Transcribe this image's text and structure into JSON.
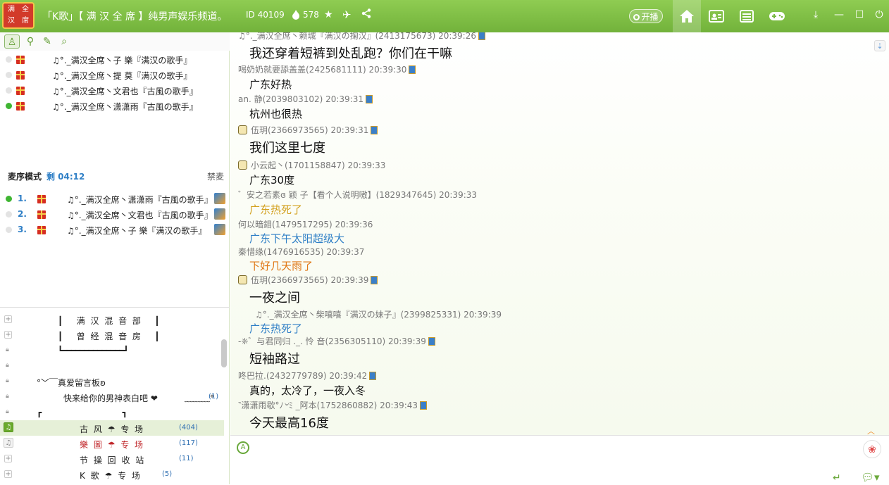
{
  "titlebar": {
    "title": "「K歌」【 满 汉 全 席 】纯男声娱乐频道。",
    "room_id": "ID 40109",
    "popularity": "578",
    "broadcast_label": "开播",
    "logo_text": [
      "满",
      "全",
      "汉",
      "席"
    ]
  },
  "online_users": [
    {
      "name": "♫°._满汉全席丶子   樂『满汉の歌手』",
      "online": false
    },
    {
      "name": "♫°._满汉全席丶提   莫『满汉の歌手』",
      "online": false
    },
    {
      "name": "♫°._满汉全席丶文君也『古風の歌手』",
      "online": false
    },
    {
      "name": "♫°._满汉全席丶潇潇雨『古風の歌手』",
      "online": true
    }
  ],
  "queue": {
    "mode_label": "麦序模式",
    "remaining": "剩 04:12",
    "ban_label": "禁麦",
    "items": [
      {
        "num": "1.",
        "name": "♫°._满汉全席丶潇潇雨『古風の歌手』",
        "online": true
      },
      {
        "num": "2.",
        "name": "♫°._满汉全席丶文君也『古風の歌手』",
        "online": false
      },
      {
        "num": "3.",
        "name": "♫°._满汉全席丶子   樂『满汉の歌手』",
        "online": false
      }
    ]
  },
  "rooms": [
    {
      "icon": "expand",
      "name": "┃   满 汉 混 音 部   ┃",
      "count": ""
    },
    {
      "icon": "expand",
      "name": "┃   曾 经 混 音 房   ┃",
      "count": ""
    },
    {
      "icon": "lock",
      "name": "┗━━━━━━━━━━━━━━┛",
      "count": ""
    },
    {
      "icon": "lock",
      "name": "",
      "count": ""
    },
    {
      "icon": "lock",
      "name": "°﹀￣真爱留言板ʚ",
      "count": ""
    },
    {
      "icon": "lock",
      "name": "快来给你的男神表白吧 ❤          ﹏﹏﹏°",
      "count": "(1)"
    },
    {
      "icon": "lock",
      "name": "┏                              ┓",
      "count": ""
    },
    {
      "icon": "music-green",
      "name": "古 风 ☂ 专 场",
      "count": "(404)"
    },
    {
      "icon": "music",
      "name": "樂 圖 ☂ 专 场",
      "count": "(117)"
    },
    {
      "icon": "expand",
      "name": "节 操 回 收 站",
      "count": "(11)"
    },
    {
      "icon": "expand",
      "name": "K 歌 ☂ 专 场",
      "count": "(5)"
    }
  ],
  "chat": [
    {
      "meta": "♫°._满汉全席丶赖城『满汉の掬汉』(2413175673) 20:39:26",
      "text": "我还穿着短裤到处乱跑？你们在干嘛",
      "size": "lg",
      "color": ""
    },
    {
      "meta": "喝奶奶就要舔盖盖(2425681111) 20:39:30",
      "text": "广东好热",
      "size": "md",
      "color": ""
    },
    {
      "meta": "an. 静(2039803102) 20:39:31",
      "text": "杭州也很热",
      "size": "md",
      "color": ""
    },
    {
      "meta": "伍玥(2366973565) 20:39:31",
      "text": "我们这里七度",
      "size": "lg",
      "color": ""
    },
    {
      "meta": "小云起丶(1701158847) 20:39:33",
      "text": "广东30度",
      "size": "md",
      "color": ""
    },
    {
      "meta": "゛安之若素ɞ 颖   子【看个人说明嗷】(1829347645) 20:39:33",
      "text": "广东热死了",
      "size": "md",
      "color": "yellow"
    },
    {
      "meta": "何以暗鉬(1479517295) 20:39:36",
      "text": "广东下午太阳超级大",
      "size": "md",
      "color": "blue"
    },
    {
      "meta": "秦惜缘(1476916535) 20:39:37",
      "text": "下好几天雨了",
      "size": "md",
      "color": "orange"
    },
    {
      "meta": "伍玥(2366973565) 20:39:39",
      "text": "一夜之间",
      "size": "lg",
      "color": ""
    },
    {
      "meta": "♫°._满汉全席丶柴嘻嘻『满汉の妹子』(2399825331) 20:39:39",
      "text": "广东热死了",
      "size": "md",
      "color": "blue"
    },
    {
      "meta": "-❈゛与君同归 ._. 怜   音(2356305110) 20:39:39",
      "text": "短袖路过",
      "size": "lg",
      "color": ""
    },
    {
      "meta": "咚巴拉.(2432779789) 20:39:42",
      "text": "真的，太冷了，一夜入冬",
      "size": "md",
      "color": ""
    },
    {
      "meta": "‶潇潇雨歇°ﾉ৺ﾐ _阿本(1752860882) 20:39:43",
      "text": "今天最高16度",
      "size": "lg",
      "color": ""
    }
  ]
}
